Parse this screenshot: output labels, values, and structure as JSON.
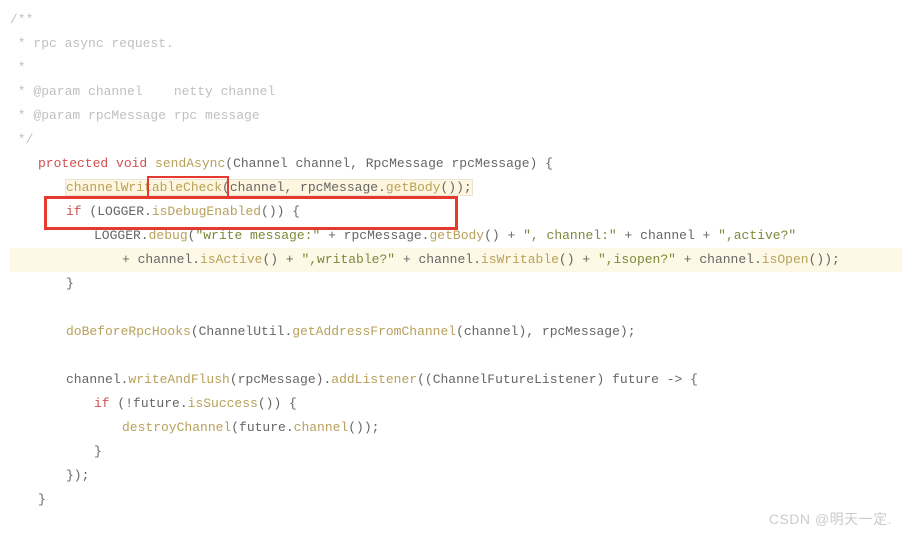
{
  "comment": {
    "l1": "/**",
    "l2": " * rpc async request.",
    "l3": " *",
    "l4": " * @param channel    netty channel",
    "l5": " * @param rpcMessage rpc message",
    "l6": " */"
  },
  "sig": {
    "protected": "protected",
    "void": "void",
    "name": " sendAsync",
    "params": "(Channel channel, RpcMessage rpcMessage) {"
  },
  "body": {
    "check": {
      "fn": "channelWritableCheck",
      "args_open": "(channel, rpcMessage.",
      "getBody": "getBody",
      "args_close": "());"
    },
    "ifLogger": {
      "if": "if",
      "cond1": " (LOGGER.",
      "isDebug": "isDebugEnabled",
      "cond2": "()) {"
    },
    "loggerDebug": {
      "pre": "LOGGER.",
      "debug": "debug",
      "open": "(",
      "s1": "\"write message:\"",
      "p1": " + rpcMessage.",
      "getBody": "getBody",
      "p2": "() + ",
      "s2": "\", channel:\"",
      "p3": " + channel + ",
      "s3": "\",active?\""
    },
    "loggerDebugCont": {
      "p0": "+ channel.",
      "isActive": "isActive",
      "p1": "() + ",
      "s1": "\",writable?\"",
      "p2": " + channel.",
      "isWritable": "isWritable",
      "p3": "() + ",
      "s2": "\",isopen?\"",
      "p4": " + channel.",
      "isOpen": "isOpen",
      "p5": "());"
    },
    "closeIf": "}",
    "hooks": {
      "fn": "doBeforeRpcHooks",
      "open": "(ChannelUtil.",
      "getAddr": "getAddressFromChannel",
      "rest": "(channel), rpcMessage);"
    },
    "write": {
      "pre": "channel.",
      "waf": "writeAndFlush",
      "mid": "(rpcMessage).",
      "addL": "addListener",
      "rest": "((ChannelFutureListener) future -> {"
    },
    "ifSuccess": {
      "if": "if",
      "open": " (!future.",
      "isSuccess": "isSuccess",
      "close": "()) {"
    },
    "destroy": {
      "fn": "destroyChannel",
      "open": "(future.",
      "channel": "channel",
      "close": "());"
    },
    "closeInnerIf": "}",
    "closeLambda": "});",
    "closeMethod": "}"
  },
  "watermark": "CSDN @明天一定."
}
